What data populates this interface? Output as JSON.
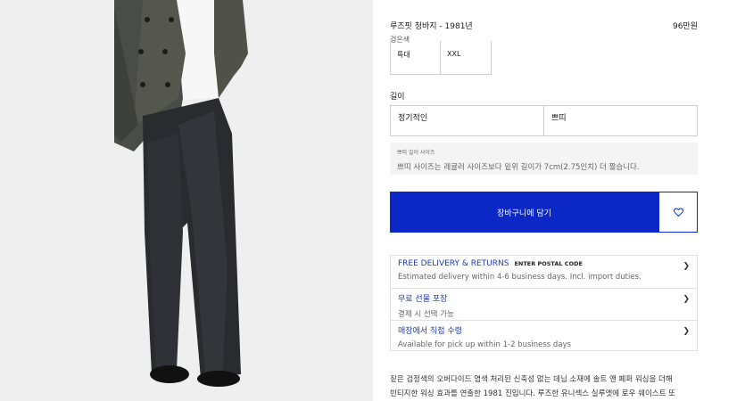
{
  "product": {
    "title": "루즈핏 청바지 - 1981년",
    "price": "96만원",
    "color": "검은색"
  },
  "sizes": [
    "특대",
    "XXL"
  ],
  "length": {
    "label": "길이",
    "options": [
      "정기적인",
      "쁘띠"
    ]
  },
  "petite_info": {
    "title": "쁘띠 길이 사이즈",
    "text": "쁘띠 사이즈는 레귤러 사이즈보다 밑위 길이가 7cm(2.75인치) 더 짧습니다."
  },
  "cart": {
    "add_label": "장바구니에 담기",
    "wish_icon": "heart-icon"
  },
  "info": {
    "delivery": {
      "title": "FREE DELIVERY & RETURNS",
      "postal": "ENTER POSTAL CODE",
      "sub": "Estimated delivery within 4-6 business days. Incl. import duties."
    },
    "gift": {
      "title": "무료 선물 포장",
      "sub": "결제 시 선택 가능"
    },
    "pickup": {
      "title": "매장에서 직접 수령",
      "sub": "Available for pick up within 1-2 business days"
    }
  },
  "description": {
    "line1": "짙은 검정색의 오버다이드 염색 처리된 신축성 없는 데님 소재에 솔트 앤 페퍼 워싱을 더해",
    "line2": "빈티지한 워싱 효과를 연출한 1981 진입니다. 루즈한 유니섹스 실루엣에 로우 웨이스트 또"
  },
  "colors": {
    "accent": "#0b28c7",
    "link": "#1e3ab8"
  }
}
